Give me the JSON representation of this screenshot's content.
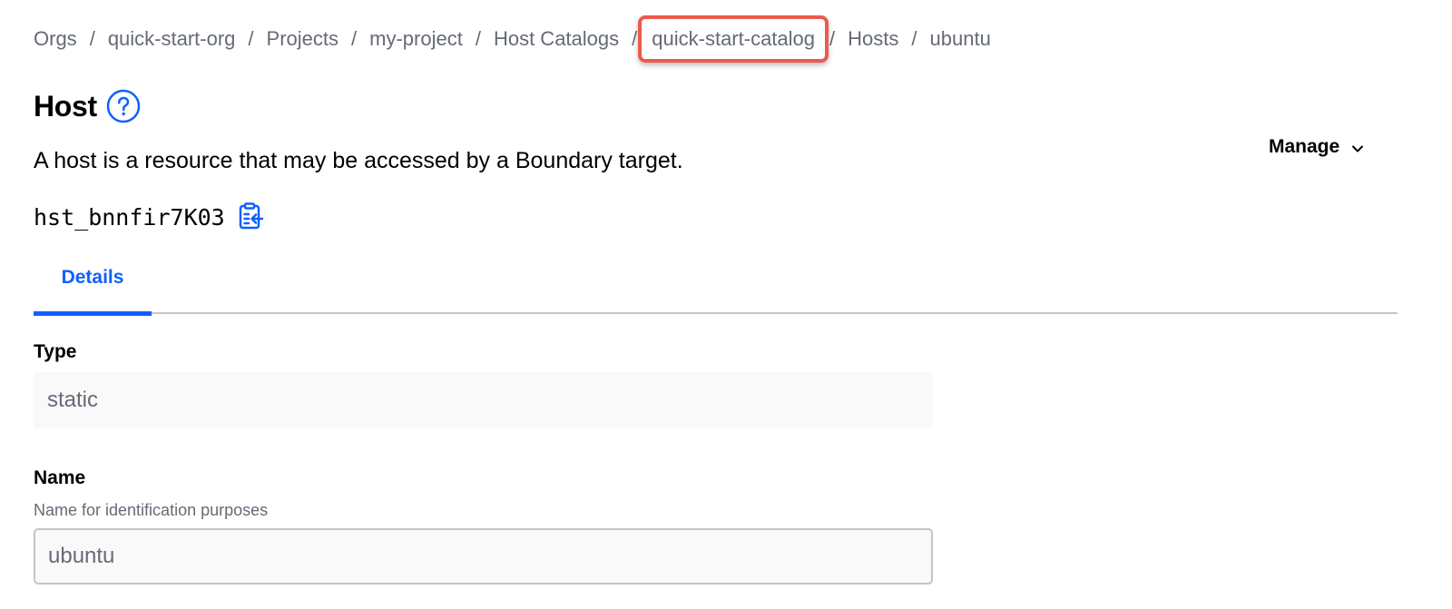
{
  "breadcrumb": {
    "items": [
      "Orgs",
      "quick-start-org",
      "Projects",
      "my-project",
      "Host Catalogs",
      "quick-start-catalog",
      "Hosts",
      "ubuntu"
    ],
    "separator": "/"
  },
  "header": {
    "title": "Host",
    "description": "A host is a resource that may be accessed by a Boundary target.",
    "manage_label": "Manage",
    "host_id": "hst_bnnfir7K03"
  },
  "tabs": [
    {
      "label": "Details",
      "active": true
    }
  ],
  "form": {
    "type": {
      "label": "Type",
      "value": "static"
    },
    "name": {
      "label": "Name",
      "help": "Name for identification purposes",
      "value": "ubuntu"
    }
  },
  "icons": {
    "help": "help-circle-icon",
    "copy": "clipboard-copy-icon",
    "manage_chevron": "chevron-down-icon"
  },
  "colors": {
    "accent": "#1060ff",
    "highlight": "#ec5a4f",
    "muted_text": "#656a76"
  }
}
